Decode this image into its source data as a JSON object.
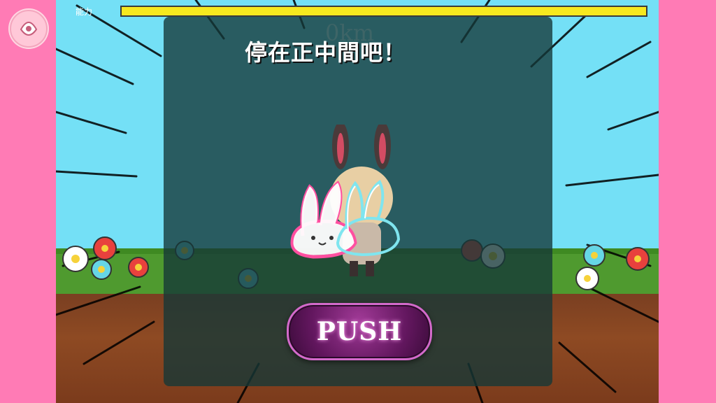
{
  "hud": {
    "power_label": "能力",
    "power_level": 1.0,
    "distance": "0km"
  },
  "dialog": {
    "title": "停在正中間吧！",
    "push_label": "PUSH"
  },
  "colors": {
    "side_panels": "#ff7bb5",
    "sky": "#74e0f6",
    "power_bar": "#f7e91f",
    "button": "#63175f",
    "overlay": "rgba(20,55,55,0.78)"
  },
  "icons": [
    "logo-icon",
    "rabbit-cursor-icon",
    "character-icon"
  ]
}
